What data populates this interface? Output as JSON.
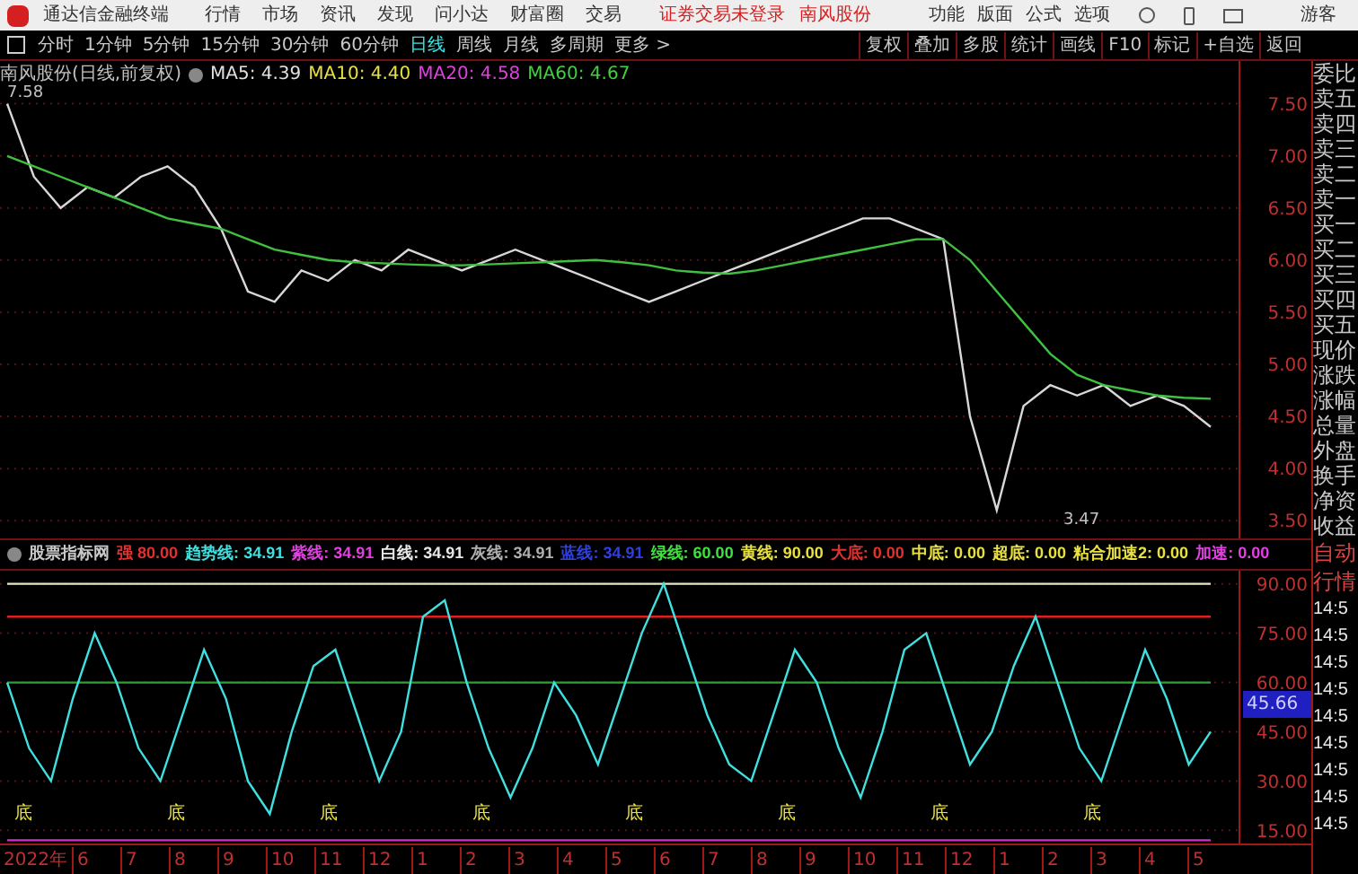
{
  "title_bar": {
    "app_name": "通达信金融终端",
    "menu": [
      "行情",
      "市场",
      "资讯",
      "发现",
      "问小达",
      "财富圈",
      "交易"
    ],
    "login_status": "证券交易未登录",
    "stock_name": "南风股份",
    "tools": [
      "功能",
      "版面",
      "公式",
      "选项"
    ],
    "user": "游客"
  },
  "period_tabs": [
    {
      "label": "分时",
      "selected": false
    },
    {
      "label": "1分钟",
      "selected": false
    },
    {
      "label": "5分钟",
      "selected": false
    },
    {
      "label": "15分钟",
      "selected": false
    },
    {
      "label": "30分钟",
      "selected": false
    },
    {
      "label": "60分钟",
      "selected": false
    },
    {
      "label": "日线",
      "selected": true
    },
    {
      "label": "周线",
      "selected": false
    },
    {
      "label": "月线",
      "selected": false
    },
    {
      "label": "多周期",
      "selected": false
    },
    {
      "label": "更多 >",
      "selected": false
    }
  ],
  "chart_buttons": [
    "复权",
    "叠加",
    "多股",
    "统计",
    "画线",
    "F10",
    "标记",
    "+自选",
    "返回"
  ],
  "price_panel": {
    "title": "南风股份(日线,前复权)",
    "indicators": [
      {
        "label": "MA5: 4.39",
        "color": "#e0e0e0"
      },
      {
        "label": "MA10: 4.40",
        "color": "#e8e040"
      },
      {
        "label": "MA20: 4.58",
        "color": "#e040e0"
      },
      {
        "label": "MA60: 4.67",
        "color": "#40d040"
      }
    ],
    "high_label": "7.58",
    "low_label": "3.47",
    "chart_data": {
      "type": "line",
      "grid": true,
      "ylim": [
        3.33,
        7.91
      ],
      "yticks": [
        {
          "value": 7.5,
          "label": "7.50"
        },
        {
          "value": 7.0,
          "label": "7.00"
        },
        {
          "value": 6.5,
          "label": "6.50"
        },
        {
          "value": 6.0,
          "label": "6.00"
        },
        {
          "value": 5.5,
          "label": "5.50"
        },
        {
          "value": 5.0,
          "label": "5.00"
        },
        {
          "value": 4.5,
          "label": "4.50"
        },
        {
          "value": 4.0,
          "label": "4.00"
        },
        {
          "value": 3.5,
          "label": "3.50"
        }
      ],
      "series": [
        {
          "color": "#d8d8d8",
          "values": [
            7.5,
            6.8,
            6.5,
            6.7,
            6.6,
            6.8,
            6.9,
            6.7,
            6.3,
            5.7,
            5.6,
            5.9,
            5.8,
            6.0,
            5.9,
            6.1,
            6.0,
            5.9,
            6.0,
            6.1,
            6.0,
            5.9,
            5.8,
            5.7,
            5.6,
            5.7,
            5.8,
            5.9,
            6.0,
            6.1,
            6.2,
            6.3,
            6.4,
            6.4,
            6.3,
            6.2,
            4.5,
            3.6,
            4.6,
            4.8,
            4.7,
            4.8,
            4.6,
            4.7,
            4.6,
            4.4
          ]
        },
        {
          "color": "#40c040",
          "values": [
            7.0,
            6.9,
            6.8,
            6.7,
            6.6,
            6.5,
            6.4,
            6.35,
            6.3,
            6.2,
            6.1,
            6.05,
            6.0,
            5.98,
            5.97,
            5.96,
            5.95,
            5.95,
            5.96,
            5.97,
            5.98,
            5.99,
            6.0,
            5.98,
            5.95,
            5.9,
            5.88,
            5.87,
            5.9,
            5.95,
            6.0,
            6.05,
            6.1,
            6.15,
            6.2,
            6.2,
            6.0,
            5.7,
            5.4,
            5.1,
            4.9,
            4.8,
            4.75,
            4.7,
            4.68,
            4.67
          ]
        }
      ]
    }
  },
  "indicator_panel": {
    "title": "股票指标网",
    "values": [
      {
        "label": "强",
        "value": "80.00",
        "color": "#e03030"
      },
      {
        "label": "趋势线:",
        "value": "34.91",
        "color": "#40e0e0"
      },
      {
        "label": "紫线:",
        "value": "34.91",
        "color": "#e040e0"
      },
      {
        "label": "白线:",
        "value": "34.91",
        "color": "#e8e8e8"
      },
      {
        "label": "灰线:",
        "value": "34.91",
        "color": "#b0b0b0"
      },
      {
        "label": "蓝线:",
        "value": "34.91",
        "color": "#3040e0"
      },
      {
        "label": "绿线:",
        "value": "60.00",
        "color": "#40e040"
      },
      {
        "label": "黄线:",
        "value": "90.00",
        "color": "#e8e040"
      },
      {
        "label": "大底:",
        "value": "0.00",
        "color": "#e03030"
      },
      {
        "label": "中底:",
        "value": "0.00",
        "color": "#e8e040"
      },
      {
        "label": "超底:",
        "value": "0.00",
        "color": "#e8e040"
      },
      {
        "label": "粘合加速2:",
        "value": "0.00",
        "color": "#e8e040"
      },
      {
        "label": "加速:",
        "value": "0.00",
        "color": "#e040e0"
      }
    ],
    "marks": [
      "底",
      "底",
      "底",
      "底",
      "底",
      "底",
      "底",
      "底"
    ],
    "current_value": "45.66",
    "chart_data": {
      "type": "line",
      "grid": true,
      "ylim": [
        11,
        94
      ],
      "yticks": [
        {
          "value": 90,
          "label": "90.00"
        },
        {
          "value": 75,
          "label": "75.00"
        },
        {
          "value": 60,
          "label": "60.00"
        },
        {
          "value": 45,
          "label": "45.00"
        },
        {
          "value": 30,
          "label": "30.00"
        },
        {
          "value": 15,
          "label": "15.00"
        }
      ],
      "series": [
        {
          "color": "#e8e8c0",
          "values": [
            90,
            90,
            90,
            90,
            90,
            90,
            90,
            90,
            90,
            90,
            90,
            90,
            90,
            90,
            90,
            90,
            90,
            90,
            90,
            90,
            90,
            90,
            90,
            90,
            90,
            90,
            90,
            90,
            90,
            90,
            90,
            90,
            90,
            90,
            90,
            90,
            90,
            90,
            90,
            90,
            90,
            90,
            90,
            90,
            90,
            90,
            90,
            90,
            90,
            90,
            90,
            90,
            90,
            90,
            90,
            90
          ]
        },
        {
          "color": "#e02020",
          "values": [
            80,
            80,
            80,
            80,
            80,
            80,
            80,
            80,
            80,
            80,
            80,
            80,
            80,
            80,
            80,
            80,
            80,
            80,
            80,
            80,
            80,
            80,
            80,
            80,
            80,
            80,
            80,
            80,
            80,
            80,
            80,
            80,
            80,
            80,
            80,
            80,
            80,
            80,
            80,
            80,
            80,
            80,
            80,
            80,
            80,
            80,
            80,
            80,
            80,
            80,
            80,
            80,
            80,
            80,
            80,
            80
          ]
        },
        {
          "color": "#30a030",
          "values": [
            60,
            60,
            60,
            60,
            60,
            60,
            60,
            60,
            60,
            60,
            60,
            60,
            60,
            60,
            60,
            60,
            60,
            60,
            60,
            60,
            60,
            60,
            60,
            60,
            60,
            60,
            60,
            60,
            60,
            60,
            60,
            60,
            60,
            60,
            60,
            60,
            60,
            60,
            60,
            60,
            60,
            60,
            60,
            60,
            60,
            60,
            60,
            60,
            60,
            60,
            60,
            60,
            60,
            60,
            60,
            60
          ]
        },
        {
          "color": "#d030d0",
          "values": [
            12,
            12,
            12,
            12,
            12,
            12,
            12,
            12,
            12,
            12,
            12,
            12,
            12,
            12,
            12,
            12,
            12,
            12,
            12,
            12,
            12,
            12,
            12,
            12,
            12,
            12,
            12,
            12,
            12,
            12,
            12,
            12,
            12,
            12,
            12,
            12,
            12,
            12,
            12,
            12,
            12,
            12,
            12,
            12,
            12,
            12,
            12,
            12,
            12,
            12,
            12,
            12,
            12,
            12,
            12,
            12
          ]
        },
        {
          "color": "#40e0e0",
          "values": [
            60,
            40,
            30,
            55,
            75,
            60,
            40,
            30,
            50,
            70,
            55,
            30,
            20,
            45,
            65,
            70,
            50,
            30,
            45,
            80,
            85,
            60,
            40,
            25,
            40,
            60,
            50,
            35,
            55,
            75,
            90,
            70,
            50,
            35,
            30,
            50,
            70,
            60,
            40,
            25,
            45,
            70,
            75,
            55,
            35,
            45,
            65,
            80,
            60,
            40,
            30,
            50,
            70,
            55,
            35,
            45
          ]
        }
      ]
    }
  },
  "right_panel": {
    "labels": [
      "委比",
      "卖五",
      "卖四",
      "卖三",
      "卖二",
      "卖一",
      "买一",
      "买二",
      "买三",
      "买四",
      "买五",
      "现价",
      "涨跌",
      "涨幅",
      "总量",
      "外盘",
      "换手",
      "净资",
      "收益"
    ],
    "bottom_labels": [
      "自动",
      "行情"
    ],
    "times": [
      "14:5",
      "14:5",
      "14:5",
      "14:5",
      "14:5",
      "14:5",
      "14:5",
      "14:5",
      "14:5"
    ]
  },
  "x_axis": [
    "2022年",
    "6",
    "7",
    "8",
    "9",
    "10",
    "11",
    "12",
    "1",
    "2",
    "3",
    "4",
    "5",
    "6",
    "7",
    "8",
    "9",
    "10",
    "11",
    "12",
    "1",
    "2",
    "3",
    "4",
    "5"
  ]
}
